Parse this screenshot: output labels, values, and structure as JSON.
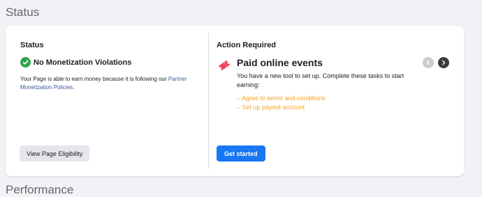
{
  "page": {
    "title": "Status",
    "next_section_title": "Performance"
  },
  "status": {
    "heading": "Status",
    "title": "No Monetization Violations",
    "description": "Your Page is able to earn money because it is following our",
    "policy_link": "Partner Monetization Policies",
    "link_suffix": ".",
    "eligibility_button": "View Page Eligibility",
    "icon": "check-circle-icon",
    "accent_color": "#31a24c"
  },
  "action": {
    "heading": "Action Required",
    "title": "Paid online events",
    "description": "You have a new tool to set up. Complete these tasks to start earning:",
    "tasks": [
      "– Agree to terms and conditions",
      "– Set up payout account"
    ],
    "cta_button": "Get started",
    "icon": "ticket-icon",
    "icon_color": "#f3425f",
    "task_color": "#f5a623",
    "button_color": "#1877f2"
  }
}
